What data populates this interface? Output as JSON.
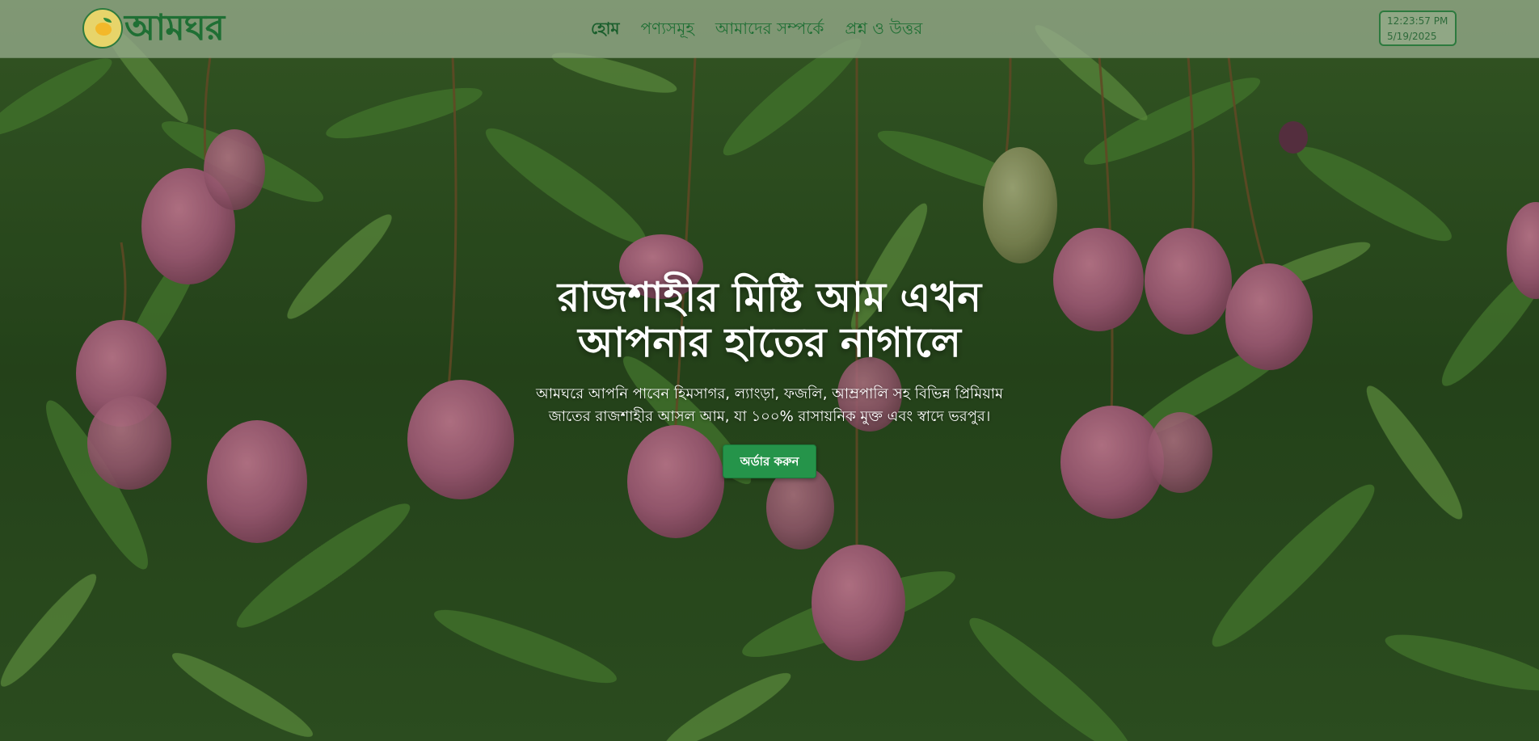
{
  "header": {
    "logo_text": "আমঘর",
    "nav": [
      {
        "label": "হোম",
        "active": true
      },
      {
        "label": "পণ্যসমূহ",
        "active": false
      },
      {
        "label": "আমাদের সম্পর্কে",
        "active": false
      },
      {
        "label": "প্রশ্ন ও উত্তর",
        "active": false
      }
    ],
    "clock": {
      "time": "12:23:57 PM",
      "date": "5/19/2025"
    }
  },
  "hero": {
    "title_line1": "রাজশাহীর মিষ্টি আম এখন",
    "title_line2": "আপনার হাতের নাগালে",
    "description": "আমঘরে আপনি পাবেন হিমসাগর, ল্যাংড়া, ফজলি, আম্রপালি সহ বিভিন্ন প্রিমিয়াম জাতের রাজশাহীর আসল আম, যা ১০০% রাসায়নিক মুক্ত এবং স্বাদে ভরপুর।",
    "cta_label": "অর্ডার করুন"
  },
  "colors": {
    "brand_green": "#1f6f34",
    "button_green": "#25944a",
    "header_bg": "#96aa8c"
  }
}
